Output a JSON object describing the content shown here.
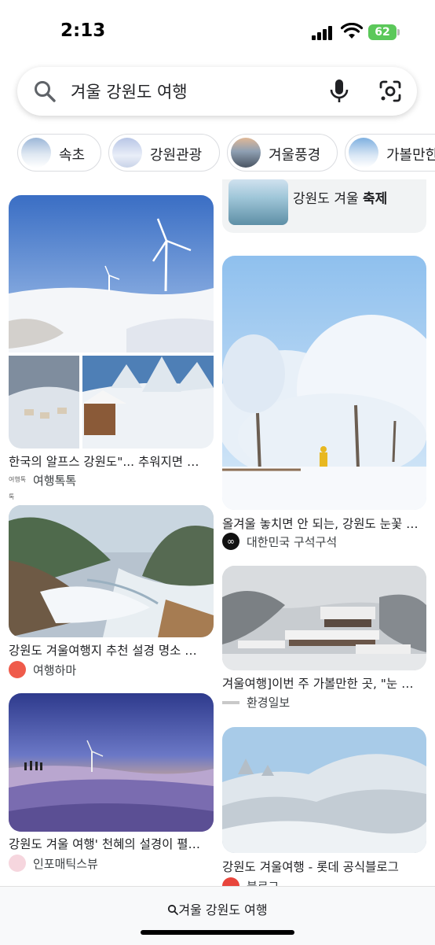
{
  "status": {
    "time": "2:13",
    "battery": "62"
  },
  "search": {
    "query": "겨울 강원도 여행"
  },
  "chips": [
    {
      "label": "속초"
    },
    {
      "label": "강원관광"
    },
    {
      "label": "겨울풍경"
    },
    {
      "label": "가볼만한"
    }
  ],
  "festival": {
    "prefix": "강원도 겨울 ",
    "bold": "축제"
  },
  "results": [
    {
      "title": "한국의 알프스 강원도\"... 추워지면 …",
      "source": "여행톡톡",
      "source_mark": "여행톡톡"
    },
    {
      "title": "올겨울 놓치면 안 되는, 강원도 눈꽃 …",
      "source": "대한민국 구석구석",
      "source_mark": "∞"
    },
    {
      "title": "강원도 겨울여행지 추천 설경 명소 …",
      "source": "여행하마",
      "source_mark": ""
    },
    {
      "title": "겨울여행]이번 주 가볼만한 곳, \"눈 …",
      "source": "환경일보",
      "source_mark": ""
    },
    {
      "title": "강원도 겨울 여행' 천혜의 설경이 펼…",
      "source": "인포매틱스뷰",
      "source_mark": ""
    },
    {
      "title": "강원도 겨울여행 - 롯데 공식블로그",
      "source": "블로그",
      "source_mark": ""
    }
  ],
  "bottom": {
    "query": "겨울 강원도 여행"
  },
  "colors": {
    "accent": "#1a73e8",
    "battery": "#5bc85a",
    "chip_border": "#dadce0"
  }
}
